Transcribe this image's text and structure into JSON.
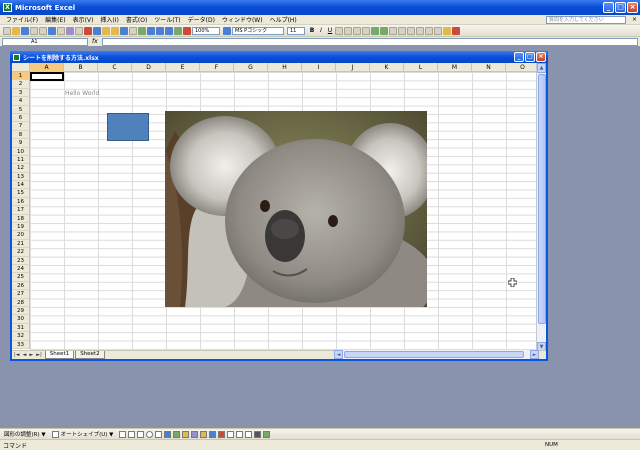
{
  "app": {
    "title": "Microsoft Excel"
  },
  "window_buttons": [
    "_",
    "□",
    "X"
  ],
  "menu": {
    "items": [
      "ファイル(F)",
      "編集(E)",
      "表示(V)",
      "挿入(I)",
      "書式(O)",
      "ツール(T)",
      "データ(D)",
      "ウィンドウ(W)",
      "ヘルプ(H)"
    ],
    "help_placeholder": "質問を入力してください"
  },
  "toolbar": {
    "zoom": "100%",
    "font_name": "MS Pゴシック",
    "font_size": "11",
    "bold": "B",
    "italic": "I",
    "underline": "U"
  },
  "formula_bar": {
    "name_box": "A1",
    "fx": "fx",
    "value": ""
  },
  "workbook": {
    "title": "シートを削除する方法.xlsx",
    "columns": [
      "A",
      "B",
      "C",
      "D",
      "E",
      "F",
      "G",
      "H",
      "I",
      "J",
      "K",
      "L",
      "M",
      "N",
      "O"
    ],
    "selected_column": "A",
    "rows": [
      "1",
      "2",
      "3",
      "4",
      "5",
      "6",
      "7",
      "8",
      "9",
      "10",
      "11",
      "12",
      "13",
      "14",
      "15",
      "16",
      "17",
      "18",
      "19",
      "20",
      "21",
      "22",
      "23",
      "24",
      "25",
      "26",
      "27",
      "28",
      "29",
      "30",
      "31",
      "32",
      "33"
    ],
    "selected_row": "1",
    "cells": {
      "B2": "Hello World"
    },
    "sheet_tabs": [
      "Sheet1",
      "Sheet2"
    ],
    "active_sheet": "Sheet1",
    "tab_nav": [
      "|◄",
      "◄",
      "►",
      "►|"
    ]
  },
  "draw_toolbar": {
    "draw_label": "図形の調整(R) ▼",
    "autoshape_label": "オートシェイプ(U) ▼"
  },
  "status": {
    "left": "コマンド",
    "num": "NUM"
  },
  "colors": {
    "accent": "#0a4fd8",
    "rect_shape": "#4f81bd",
    "selection": "#f7c87f"
  }
}
